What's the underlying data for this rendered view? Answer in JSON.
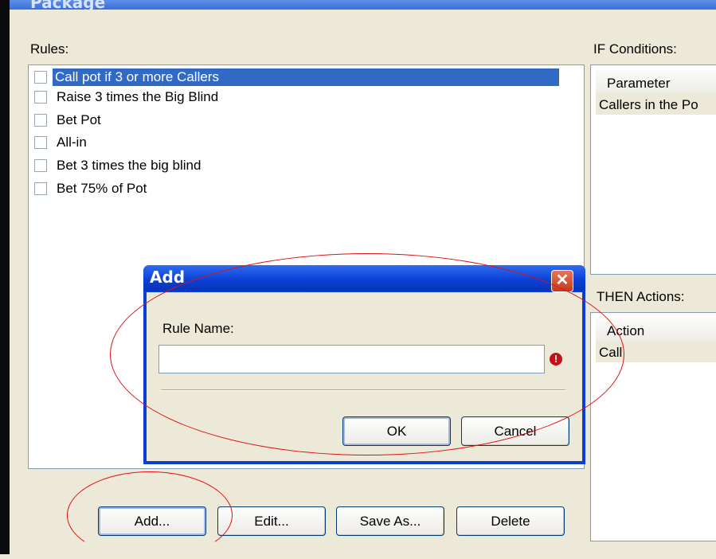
{
  "window": {
    "title": "Package"
  },
  "rules": {
    "label": "Rules:",
    "items": [
      {
        "label": "Call pot if 3 or more Callers",
        "checked": false,
        "selected": true
      },
      {
        "label": "Raise 3 times the Big Blind",
        "checked": false,
        "selected": false
      },
      {
        "label": "Bet Pot",
        "checked": false,
        "selected": false
      },
      {
        "label": "All-in",
        "checked": false,
        "selected": false
      },
      {
        "label": "Bet 3 times the big blind",
        "checked": false,
        "selected": false
      },
      {
        "label": "Bet 75% of Pot",
        "checked": false,
        "selected": false
      }
    ]
  },
  "if_conditions": {
    "label": "IF Conditions:",
    "column": "Parameter",
    "rows": [
      "Callers in the Po"
    ]
  },
  "then_actions": {
    "label": "THEN Actions:",
    "column": "Action",
    "rows": [
      "Call"
    ]
  },
  "buttons": {
    "add": "Add...",
    "edit": "Edit...",
    "save_as": "Save As...",
    "delete": "Delete"
  },
  "dialog": {
    "title": "Add",
    "field_label": "Rule Name:",
    "field_value": "",
    "warning_glyph": "!",
    "ok": "OK",
    "cancel": "Cancel"
  },
  "colors": {
    "selection": "#316ac5",
    "annotation": "#e01010",
    "dialog_title": "#0a3fd4"
  }
}
